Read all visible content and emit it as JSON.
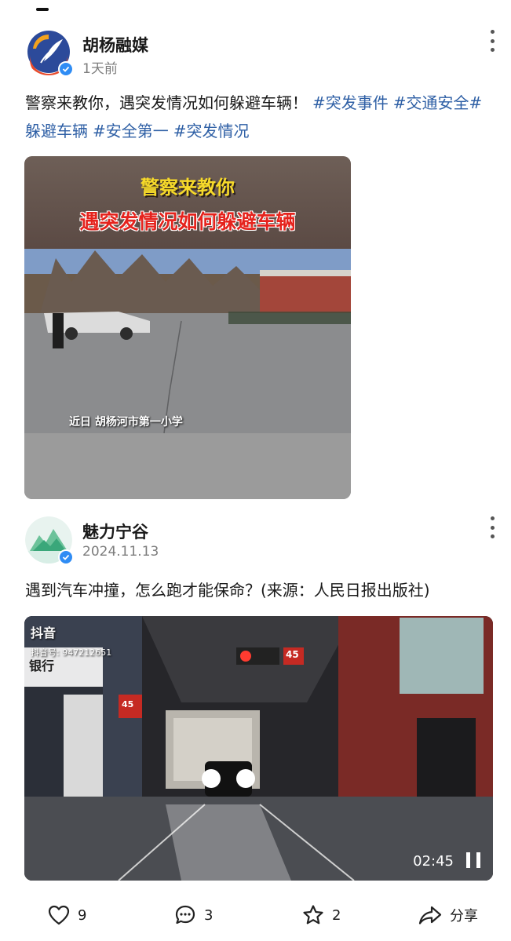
{
  "posts": [
    {
      "author": "胡杨融媒",
      "time": "1天前",
      "text": "警察来教你，遇突发情况如何躲避车辆！",
      "hashtags": [
        "#突发事件",
        "#交通安全",
        "#躲避车辆",
        "#安全第一",
        "#突发情况"
      ],
      "video": {
        "banner_line1": "警察来教你",
        "banner_line2": "遇突发情况如何躲避车辆",
        "subtitle": "近日 胡杨河市第一小学"
      }
    },
    {
      "author": "魅力宁谷",
      "time": "2024.11.13",
      "text": "遇到汽车冲撞，怎么跑才能保命？(来源：人民日报出版社)",
      "video": {
        "watermark_logo": "抖音",
        "watermark_id": "抖音号: 947212651",
        "duration": "02:45",
        "signs": [
          "银行",
          "45",
          "45"
        ]
      },
      "actions": {
        "likes": "9",
        "comments": "3",
        "favorites": "2",
        "share_label": "分享"
      }
    }
  ],
  "colors": {
    "hashtag": "#2e5fa5",
    "verified": "#2f8cf4",
    "banner_yellow": "#f6d92a",
    "banner_red": "#e5231d"
  },
  "icons": [
    "more-icon",
    "verified-icon",
    "like-icon",
    "comment-icon",
    "star-icon",
    "share-icon",
    "pause-icon",
    "douyin-icon"
  ]
}
